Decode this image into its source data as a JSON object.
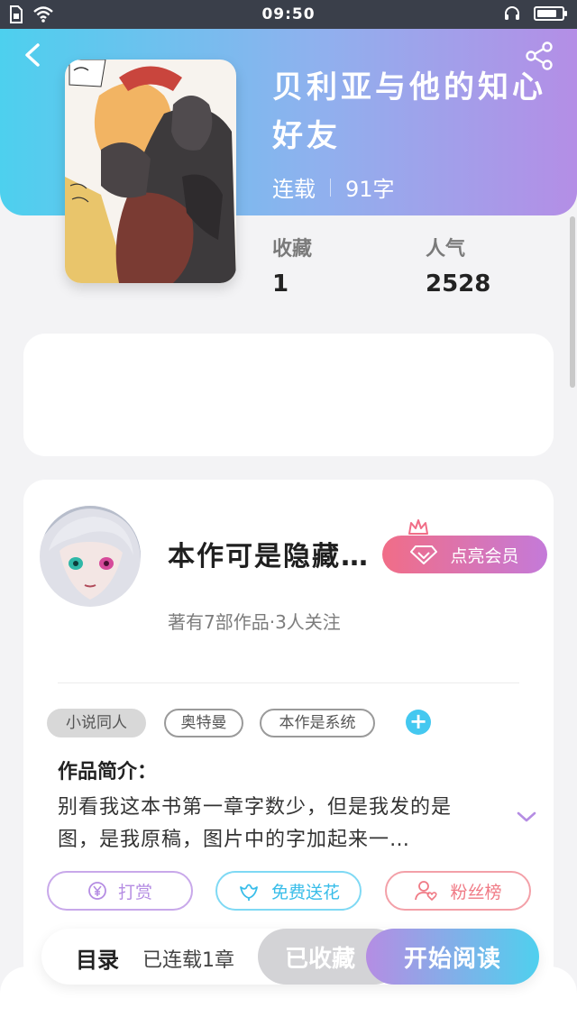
{
  "status_bar": {
    "time": "09:50",
    "left_icons": [
      "sim-card-icon",
      "wifi-icon"
    ],
    "right_icons": [
      "headset-icon",
      "battery-icon"
    ],
    "battery_level": 0.7
  },
  "header": {
    "back_icon": "chevron-left-icon",
    "share_icon": "share-icon",
    "title": "贝利亚与他的知心好友",
    "status": "连载",
    "word_count": "91字"
  },
  "stats": {
    "favorites_label": "收藏",
    "favorites_value": "1",
    "popularity_label": "人气",
    "popularity_value": "2528"
  },
  "author": {
    "name": "本作可是隐藏…",
    "summary": "著有7部作品·3人关注",
    "vip_button": "点亮会员"
  },
  "tags": [
    "小说同人",
    "奥特曼",
    "本作是系统"
  ],
  "intro": {
    "title": "作品简介：",
    "text": "别看我这本书第一章字数少，但是我发的是图，是我原稿，图片中的字加起来一…"
  },
  "actions": {
    "reward": "打赏",
    "flowers": "免费送花",
    "fans": "粉丝榜"
  },
  "bottom_bar": {
    "toc": "目录",
    "chapters": "已连载1章",
    "collected": "已收藏",
    "read": "开始阅读"
  },
  "colors": {
    "header_gradient_start": "#4dd0ee",
    "header_gradient_end": "#b48ee6",
    "vip_gradient_start": "#f16d87",
    "vip_gradient_end": "#c47ad9",
    "reward_color": "#b58de3",
    "flowers_color": "#44c8f0",
    "fans_color": "#f07a85"
  }
}
